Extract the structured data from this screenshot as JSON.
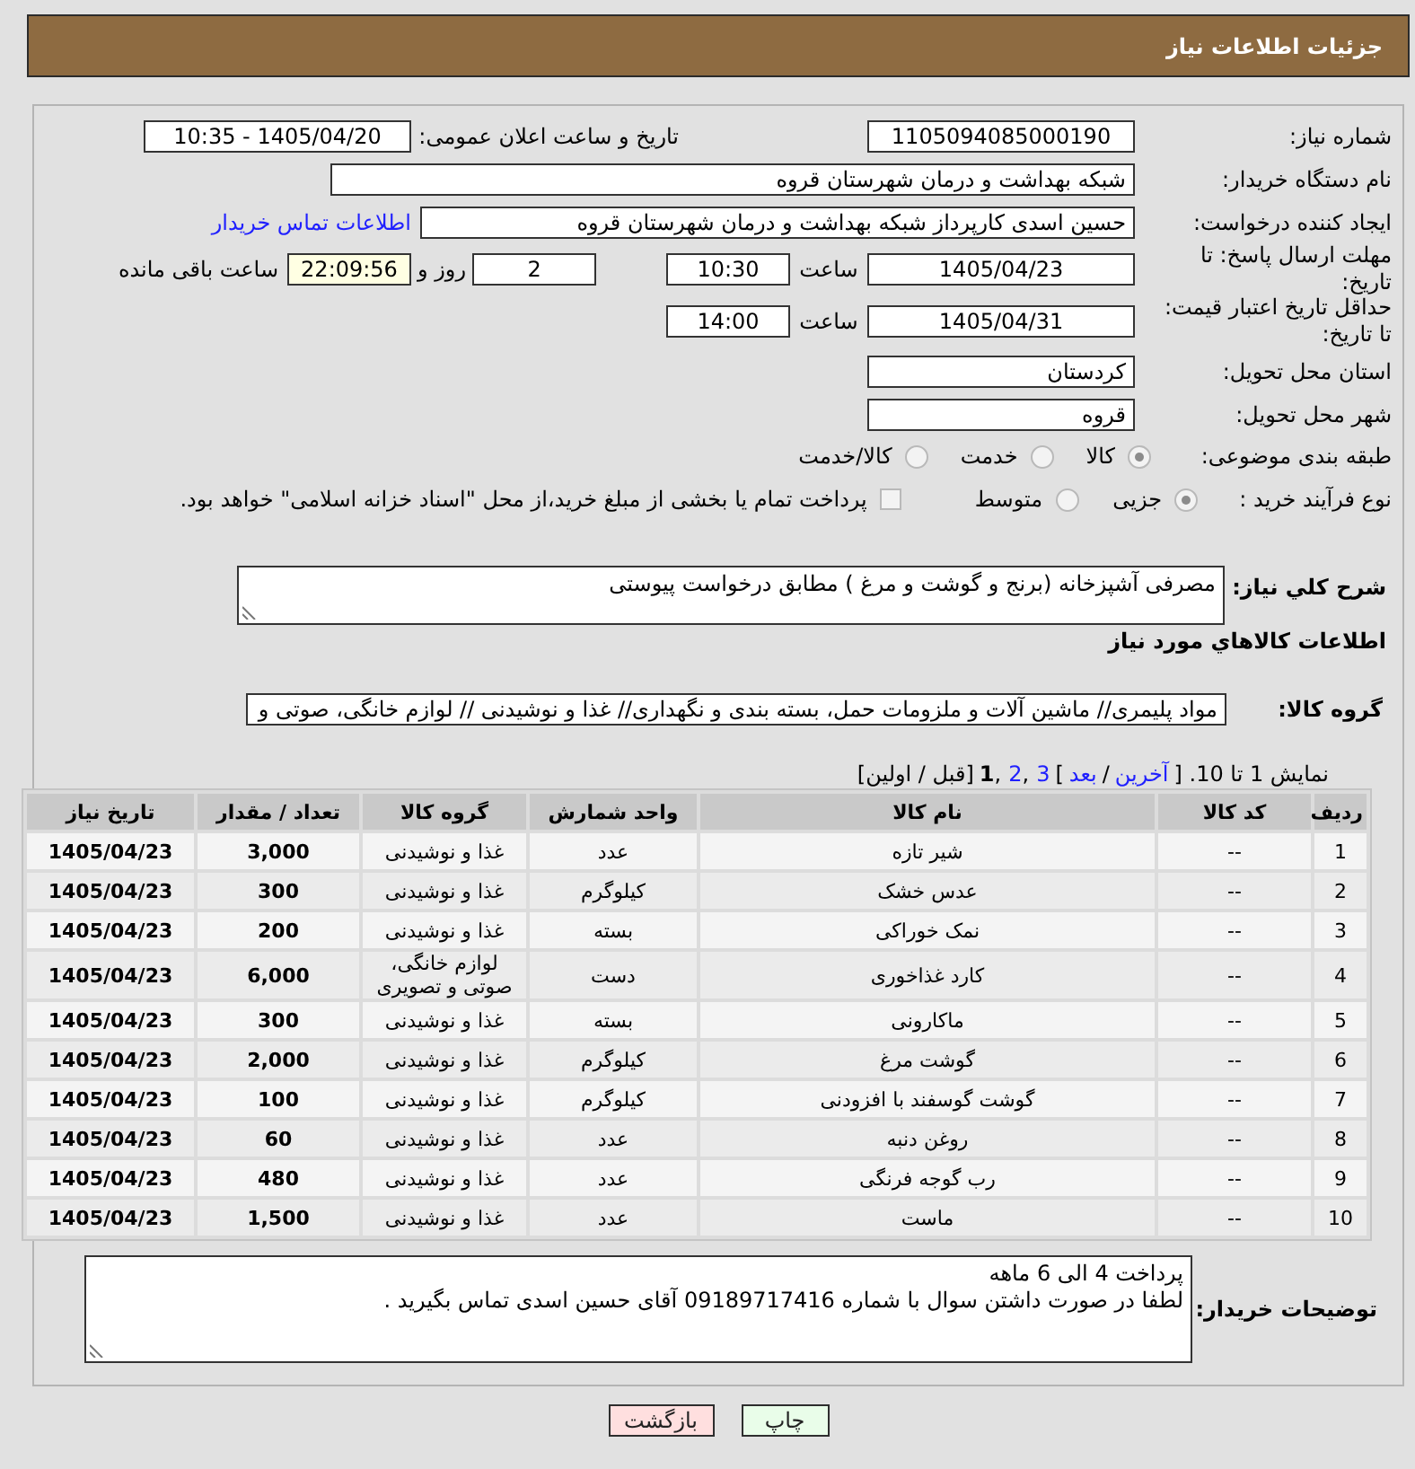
{
  "header": {
    "title": "جزئیات اطلاعات نیاز"
  },
  "form": {
    "need_number": {
      "label": "شماره نیاز:",
      "value": "1105094085000190"
    },
    "announce": {
      "label": "تاریخ و ساعت اعلان عمومی:",
      "value": "1405/04/20 - 10:35"
    },
    "buyer_org": {
      "label": "نام دستگاه خریدار:",
      "value": "شبکه بهداشت و درمان شهرستان قروه"
    },
    "requester": {
      "label": "ایجاد کننده درخواست:",
      "value": "حسین اسدی کارپرداز شبکه بهداشت و درمان شهرستان قروه",
      "link": "اطلاعات تماس خریدار"
    },
    "reply_deadline": {
      "label": "مهلت ارسال پاسخ: تا تاریخ:",
      "date": "1405/04/23",
      "time_label": "ساعت",
      "time": "10:30",
      "days": "2",
      "days_label": "روز و",
      "remaining": {
        "value": "22:09:56",
        "highlighted": true
      },
      "remaining_label": "ساعت باقی مانده"
    },
    "price_validity": {
      "label": "حداقل تاریخ اعتبار قیمت: تا تاریخ:",
      "date": "1405/04/31",
      "time_label": "ساعت",
      "time": "14:00"
    },
    "province": {
      "label": "استان محل تحویل:",
      "value": "کردستان"
    },
    "city": {
      "label": "شهر محل تحویل:",
      "value": "قروه"
    },
    "category": {
      "label": "طبقه بندی موضوعی:",
      "options": [
        {
          "label": "کالا",
          "selected": true
        },
        {
          "label": "خدمت",
          "selected": false
        },
        {
          "label": "کالا/خدمت",
          "selected": false
        }
      ]
    },
    "purchase_type": {
      "label": "نوع فرآیند خرید :",
      "options": [
        {
          "label": "جزیی",
          "selected": true
        },
        {
          "label": "متوسط",
          "selected": false
        }
      ],
      "treasury": {
        "label": "پرداخت تمام یا بخشی از مبلغ خرید،از محل \"اسناد خزانه اسلامی\" خواهد بود.",
        "checked": false
      }
    }
  },
  "description": {
    "label": "شرح کلي نیاز:",
    "value": "مصرفی آشپزخانه (برنج و گوشت و مرغ ) مطابق درخواست پیوستی"
  },
  "goods": {
    "title": "اطلاعات کالاهاي مورد نياز",
    "group_label": "گروه کالا:",
    "group_value": "مواد پلیمری// ماشین آلات و ملزومات حمل، بسته بندی و نگهداری// غذا و نوشیدنی // لوازم خانگی، صوتی و",
    "pagination": [
      {
        "kind": "text",
        "text": "نمایش 1 تا 10. ["
      },
      {
        "kind": "link",
        "text": "آخرین"
      },
      {
        "kind": "text",
        "text": "/"
      },
      {
        "kind": "link",
        "text": "بعد"
      },
      {
        "kind": "text",
        "text": "]"
      },
      {
        "kind": "link",
        "text": "3"
      },
      {
        "kind": "separator",
        "text": ","
      },
      {
        "kind": "link",
        "text": "2"
      },
      {
        "kind": "separator",
        "text": ","
      },
      {
        "kind": "current",
        "text": "1"
      },
      {
        "kind": "text",
        "text": "[قبل / اولین]"
      }
    ],
    "table": {
      "columns": [
        "ردیف",
        "کد کالا",
        "نام کالا",
        "واحد شمارش",
        "گروه کالا",
        "تعداد / مقدار",
        "تاریخ نیاز"
      ],
      "rows": [
        [
          "1",
          "--",
          "شیر تازه",
          "عدد",
          "غذا و نوشیدنی",
          "3,000",
          "1405/04/23"
        ],
        [
          "2",
          "--",
          "عدس خشک",
          "کیلوگرم",
          "غذا و نوشیدنی",
          "300",
          "1405/04/23"
        ],
        [
          "3",
          "--",
          "نمک خوراکی",
          "بسته",
          "غذا و نوشیدنی",
          "200",
          "1405/04/23"
        ],
        [
          "4",
          "--",
          "کارد غذاخوری",
          "دست",
          "لوازم خانگی، صوتی و تصویری",
          "6,000",
          "1405/04/23"
        ],
        [
          "5",
          "--",
          "ماکارونی",
          "بسته",
          "غذا و نوشیدنی",
          "300",
          "1405/04/23"
        ],
        [
          "6",
          "--",
          "گوشت مرغ",
          "کیلوگرم",
          "غذا و نوشیدنی",
          "2,000",
          "1405/04/23"
        ],
        [
          "7",
          "--",
          "گوشت گوسفند با افزودنی",
          "کیلوگرم",
          "غذا و نوشیدنی",
          "100",
          "1405/04/23"
        ],
        [
          "8",
          "--",
          "روغن دنبه",
          "عدد",
          "غذا و نوشیدنی",
          "60",
          "1405/04/23"
        ],
        [
          "9",
          "--",
          "رب گوجه فرنگی",
          "عدد",
          "غذا و نوشیدنی",
          "480",
          "1405/04/23"
        ],
        [
          "10",
          "--",
          "ماست",
          "عدد",
          "غذا و نوشیدنی",
          "1,500",
          "1405/04/23"
        ]
      ]
    }
  },
  "buyer_notes": {
    "label": "توضیحات خریدار:",
    "value": "پرداخت 4 الی 6 ماهه\nلطفا در صورت داشتن سوال با شماره 09189717416 آقای حسین اسدی تماس بگیرید ."
  },
  "buttons": [
    {
      "label": "چاپ",
      "kind": "print"
    },
    {
      "label": "بازگشت",
      "kind": "back"
    }
  ]
}
